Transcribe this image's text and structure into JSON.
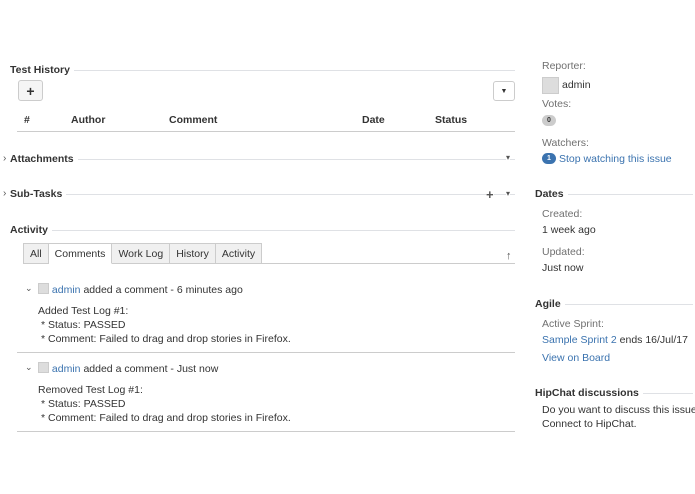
{
  "test_history": {
    "title": "Test History",
    "add_label": "+",
    "columns": [
      "#",
      "Author",
      "Comment",
      "Date",
      "Status"
    ]
  },
  "attachments": {
    "title": "Attachments"
  },
  "subtasks": {
    "title": "Sub-Tasks",
    "add_label": "+"
  },
  "activity": {
    "title": "Activity",
    "tabs": [
      "All",
      "Comments",
      "Work Log",
      "History",
      "Activity"
    ],
    "comments": [
      {
        "author": "admin",
        "action": "added a comment - 6 minutes ago",
        "lines": [
          "Added Test Log #1:",
          "* Status: PASSED",
          "* Comment: Failed to drag and drop stories in Firefox."
        ]
      },
      {
        "author": "admin",
        "action": "added a comment - Just now",
        "lines": [
          "Removed Test Log #1:",
          "* Status: PASSED",
          "* Comment: Failed to drag and drop stories in Firefox."
        ]
      }
    ]
  },
  "people": {
    "reporter_label": "Reporter:",
    "reporter_name": "admin",
    "votes_label": "Votes:",
    "votes_count": "0",
    "watchers_label": "Watchers:",
    "watchers_count": "1",
    "watch_link": "Stop watching this issue"
  },
  "dates": {
    "title": "Dates",
    "created_label": "Created:",
    "created_value": "1 week ago",
    "updated_label": "Updated:",
    "updated_value": "Just now"
  },
  "agile": {
    "title": "Agile",
    "sprint_label": "Active Sprint:",
    "sprint_link": "Sample Sprint 2",
    "sprint_end": " ends 16/Jul/17",
    "board_link": "View on Board"
  },
  "hipchat": {
    "title": "HipChat discussions",
    "line1": "Do you want to discuss this issue?",
    "line2": "Connect to HipChat."
  }
}
